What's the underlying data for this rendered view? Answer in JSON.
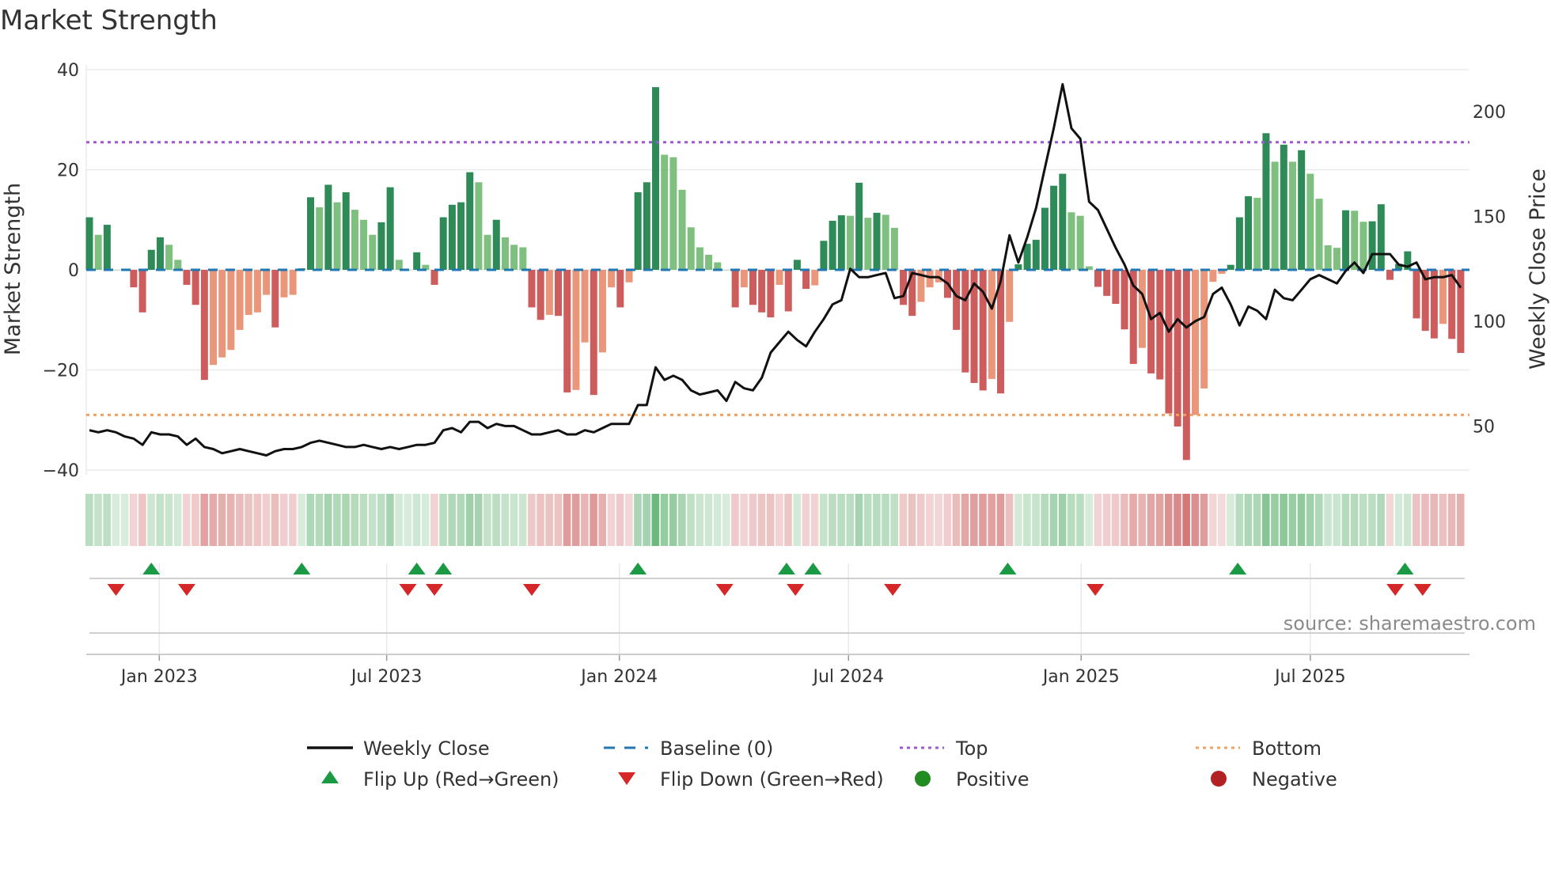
{
  "title": "Market Strength",
  "source": "source: sharemaestro.com",
  "colors": {
    "pos_rising": "#2e8b57",
    "pos_falling": "#7fbf7f",
    "neg_falling": "#cd5c5c",
    "neg_rising": "#e9967a",
    "price": "#111111",
    "baseline": "#1f77b4",
    "top": "#9b59d6",
    "bottom": "#f0a060",
    "flip_up": "#1a9a45",
    "flip_down": "#d62728",
    "positive": "#228b22",
    "negative": "#b22222"
  },
  "chart_data": {
    "type": "bar",
    "title": "Market Strength",
    "ylabel": "Market Strength",
    "y2label": "Weekly Close Price",
    "ylim": [
      -40,
      40
    ],
    "y2lim": [
      29,
      220
    ],
    "yticks": [
      "40",
      "20",
      "0",
      "−20",
      "−40"
    ],
    "ytick_values": [
      40,
      20,
      0,
      -20,
      -40
    ],
    "y2ticks": [
      "200",
      "150",
      "100",
      "50"
    ],
    "y2tick_values": [
      200,
      150,
      100,
      50
    ],
    "xticks": [
      "Jan 2023",
      "Jul 2023",
      "Jan 2024",
      "Jul 2024",
      "Jan 2025",
      "Jul 2025"
    ],
    "xtick_weeks": [
      7.9,
      33.6,
      59.9,
      85.8,
      112.1,
      138
    ],
    "top_level": 25.5,
    "bottom_level": -29,
    "baseline": 0,
    "strength": [
      10.5,
      7,
      9,
      0,
      0,
      -3.5,
      -8.5,
      4,
      6.5,
      5,
      2,
      -3,
      -7,
      -22,
      -19,
      -17.5,
      -16,
      -12,
      -9,
      -8.5,
      -5,
      -11.5,
      -5.5,
      -5,
      0.3,
      14.5,
      12.5,
      17,
      13.5,
      15.5,
      12,
      10,
      7,
      9.5,
      16.5,
      2,
      0,
      3.5,
      1,
      -3,
      10.5,
      13,
      13.5,
      19.5,
      17.5,
      7,
      10,
      6.5,
      5,
      4.5,
      -7.5,
      -10,
      -9,
      -9.2,
      -24.5,
      -24,
      -14.5,
      -25,
      -16.5,
      -3.5,
      -7.5,
      -2.5,
      15.5,
      17.5,
      36.5,
      23,
      22.5,
      16,
      8.5,
      4.5,
      3,
      1.5,
      0,
      -7.5,
      -3.5,
      -7,
      -8.5,
      -9.5,
      -3,
      -8.3,
      2,
      -3.8,
      -3.1,
      5.8,
      9.8,
      10.9,
      10.8,
      17.4,
      10.4,
      11.4,
      11,
      8.4,
      -7,
      -9.2,
      -6.4,
      -3.5,
      -2.5,
      -5.6,
      -12,
      -20.5,
      -22.6,
      -24.1,
      -21.8,
      -24.7,
      -10.4,
      1.1,
      5.2,
      6,
      12.4,
      16.8,
      19.2,
      11.5,
      10.8,
      0.7,
      -3.4,
      -5.2,
      -6.8,
      -11.9,
      -18.8,
      -15.6,
      -20.7,
      -21.9,
      -28.7,
      -31.3,
      -38,
      -29,
      -23.7,
      -2.4,
      -0.8,
      1,
      10.5,
      14.7,
      14.4,
      27.3,
      21.6,
      25,
      21.6,
      23.9,
      19.2,
      14.2,
      4.9,
      4.4,
      11.9,
      11.8,
      9.6,
      9.7,
      13.1,
      -2,
      1.2,
      3.7,
      -9.7,
      -12.2,
      -13.7,
      -10.8,
      -13.8,
      -16.6
    ],
    "weekly_close": [
      48,
      47,
      48,
      47,
      45,
      44,
      41,
      47,
      46,
      46,
      45,
      41,
      44,
      40,
      39,
      37,
      38,
      39,
      38,
      37,
      36,
      38,
      39,
      39,
      40,
      42,
      43,
      42,
      41,
      40,
      40,
      41,
      40,
      39,
      40,
      39,
      40,
      41,
      41,
      42,
      48,
      49,
      47,
      52,
      52,
      49,
      51,
      50,
      50,
      48,
      46,
      46,
      47,
      48,
      46,
      46,
      48,
      47,
      49,
      51,
      51,
      51,
      60,
      60,
      78,
      72,
      74,
      72,
      67,
      65,
      66,
      67,
      62,
      71,
      68,
      67,
      73,
      85,
      90,
      95,
      91,
      88,
      95,
      101,
      108,
      110,
      125,
      121,
      121,
      122,
      123,
      111,
      112,
      123,
      122,
      121,
      121,
      118,
      112,
      110,
      118,
      114,
      106,
      119,
      141,
      128,
      140,
      154,
      173,
      192,
      213,
      192,
      187,
      157,
      153,
      144,
      135,
      127,
      117,
      113,
      101,
      104,
      95,
      101,
      97,
      100,
      102,
      113,
      116,
      108,
      98,
      107,
      105,
      101,
      115,
      111,
      110,
      115,
      120,
      122,
      120,
      118,
      124,
      128,
      123,
      132,
      132,
      132,
      127,
      126,
      128,
      120,
      121,
      121,
      122,
      116,
      117
    ],
    "flip_up_weeks": [
      7,
      24,
      37,
      40,
      62,
      78.8,
      81.8,
      103.8,
      129.8,
      148.7
    ],
    "flip_down_weeks": [
      3,
      11,
      36,
      39,
      50,
      71.8,
      79.8,
      90.8,
      113.7,
      147.6,
      150.7
    ],
    "legend": {
      "placement": "bottom",
      "items": [
        {
          "label": "Weekly Close",
          "kind": "line"
        },
        {
          "label": "Baseline (0)",
          "kind": "dash"
        },
        {
          "label": "Top",
          "kind": "dot-top"
        },
        {
          "label": "Bottom",
          "kind": "dot-bottom"
        },
        {
          "label": "Flip Up (Red→Green)",
          "kind": "tri-up"
        },
        {
          "label": "Flip Down (Green→Red)",
          "kind": "tri-down"
        },
        {
          "label": "Positive",
          "kind": "circle-pos"
        },
        {
          "label": "Negative",
          "kind": "circle-neg"
        }
      ]
    }
  }
}
